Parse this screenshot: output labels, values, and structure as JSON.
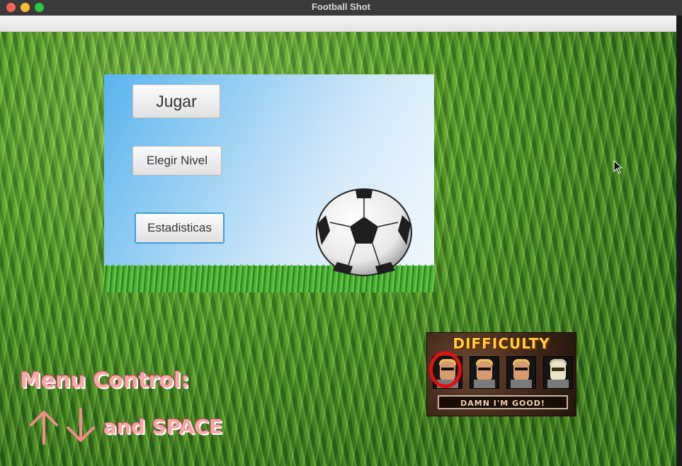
{
  "window": {
    "title": "Football Shot"
  },
  "menu": {
    "play_label": "Jugar",
    "level_label": "Elegir Nivel",
    "stats_label": "Estadisticas"
  },
  "difficulty": {
    "title": "DIFFICULTY",
    "selected_label": "DAMN I'M GOOD!",
    "selected_index": 0
  },
  "hint": {
    "title": "Menu Control:",
    "keys": "and SPACE",
    "arrow_icons": [
      "arrow-up-icon",
      "arrow-down-icon"
    ]
  },
  "colors": {
    "hint_text": "#f6a7a7",
    "focus_ring": "#3f9fd9",
    "difficulty_title": "#ffd23a",
    "selection_ring": "#e01010"
  }
}
